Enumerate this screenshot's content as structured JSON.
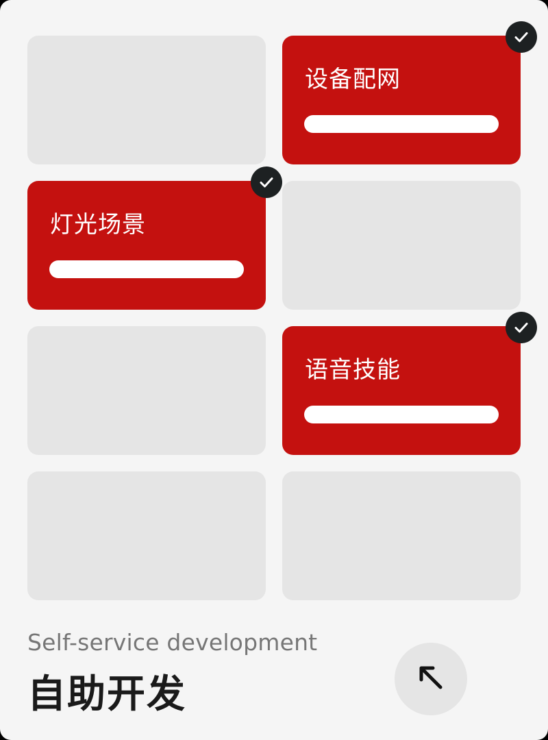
{
  "grid": {
    "tiles": [
      {
        "state": "empty"
      },
      {
        "state": "active",
        "label": "设备配网",
        "selected": true
      },
      {
        "state": "active",
        "label": "灯光场景",
        "selected": true
      },
      {
        "state": "empty"
      },
      {
        "state": "empty"
      },
      {
        "state": "active",
        "label": "语音技能",
        "selected": true
      },
      {
        "state": "empty"
      },
      {
        "state": "empty"
      }
    ]
  },
  "footer": {
    "subtitle": "Self-service development",
    "title": "自助开发",
    "action_icon": "arrow-up-left-icon"
  },
  "colors": {
    "accent": "#c4110f",
    "tile_empty": "#e5e5e5",
    "check_badge": "#1d2122",
    "background": "#f5f5f5"
  }
}
